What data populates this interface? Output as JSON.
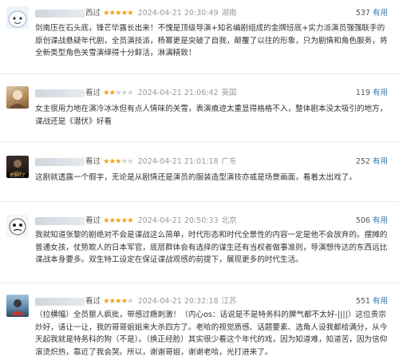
{
  "comments": [
    {
      "user_suffix": "西过",
      "stars_on": "★★★★★",
      "stars_off": "",
      "time": "2024-04-21 20:30:49",
      "location": "湖南",
      "useful_count": "537",
      "useful_label": "有用",
      "avatar_icon": "cartoon-face-avatar",
      "text": "剑南压在石头底，锋芒毕露长出来！不愧是顶级导演+知名编剧组成的金牌班底+实力派演员强强联手的原创谍战悬疑年代剧，全员演技派，杨幂更是突破了自我，颠覆了以往的形象，只为剧情和角色服务，将全新类型角色关雪演绎得十分鲜活，淋漓精致！"
    },
    {
      "user_suffix": "看过",
      "stars_on": "★★",
      "stars_off": "★★★",
      "time": "2024-04-21 21:06:42",
      "location": "英国",
      "useful_count": "119",
      "useful_label": "有用",
      "avatar_icon": "photo-avatar",
      "text": "女主很用力地在演冷冰冰但有点人情味的关雪，表演痕迹太重显得格格不入，整体剧本没太吸引的地方，谍战还是《潜伏》好看"
    },
    {
      "user_suffix": "看过",
      "stars_on": "★★★",
      "stars_off": "★★",
      "time": "2024-04-21 21:01:18",
      "location": "广东",
      "useful_count": "252",
      "useful_label": "有用",
      "avatar_icon": "dark-photo-avatar",
      "avatar_caption": "老狼红了",
      "text": "这剧就透露一个假字，无论是从剧情还是演员的服装造型演技亦或是场景画面，看着太出戏了。"
    },
    {
      "user_suffix": "看过",
      "stars_on": "★★★★★",
      "stars_off": "",
      "time": "2024-04-21 20:50:33",
      "location": "北京",
      "useful_count": "506",
      "useful_label": "有用",
      "avatar_icon": "cartoon-face-avatar",
      "text": "我就知道张黎的剧绝对不会是谍战这么简单，时代形态和时代全景性的内容一定是他不会放弃的。摆摊的普通女孩，仗势欺人的日本军官，底层群体会有选择的谋生还有当权者做事准则，导演想传达的东西远比谍战本身要多。双生特工设定在保证谍战观感的前提下，展现更多的时代生活。"
    },
    {
      "user_suffix": "看过",
      "stars_on": "★★★★",
      "stars_off": "★",
      "time": "2024-04-21 20:32:18",
      "location": "江苏",
      "useful_count": "551",
      "useful_label": "有用",
      "avatar_icon": "photo-avatar",
      "text": "（拉横幅）全员狠人疯批，带感过瘾刺激！（内心os：话说是不是特务科的脾气都不太好-||||）这位贵宗炒好，请让一让，我的哥哥姐姐来大杀四方了。老哈的视觉质感、话题要素、选角人设我都给满分，从今天起我就是特务科的狗（不是）。（换正经脸）其实很少看这个年代的戏，因为知道难，知道苦，因为信仰滚烫炽热，靠近了我会哭。所以，谢谢哥姐，谢谢老哈，光打进来了。"
    }
  ]
}
